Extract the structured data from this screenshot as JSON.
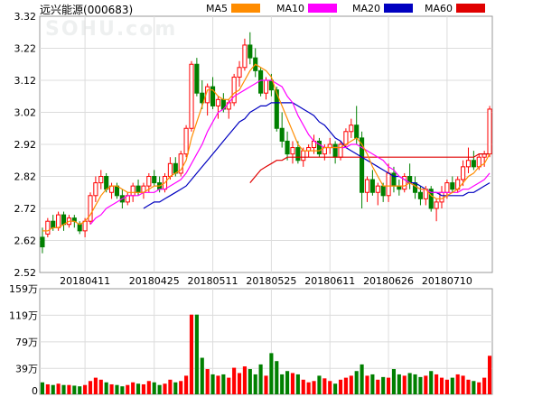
{
  "header": {
    "stock_title": "远兴能源",
    "stock_code": "(000683)",
    "watermark": "SOHU.com"
  },
  "legend": [
    {
      "name": "MA5",
      "color": "#ff8c00"
    },
    {
      "name": "MA10",
      "color": "#ff00ff"
    },
    {
      "name": "MA20",
      "color": "#0000c0"
    },
    {
      "name": "MA60",
      "color": "#e00000"
    }
  ],
  "chart_data": [
    {
      "type": "candlestick",
      "ylim": [
        2.52,
        3.32
      ],
      "y_ticks": [
        "3.32",
        "3.22",
        "3.12",
        "3.02",
        "2.92",
        "2.82",
        "2.72",
        "2.62",
        "2.52"
      ],
      "x_ticks": [
        "20180411",
        "20180425",
        "20180511",
        "20180525",
        "20180611",
        "20180626",
        "20180710"
      ],
      "up_color": "#ff0000",
      "down_color": "#008000",
      "ohlc": [
        [
          2.63,
          2.66,
          2.58,
          2.6
        ],
        [
          2.64,
          2.69,
          2.63,
          2.68
        ],
        [
          2.68,
          2.7,
          2.65,
          2.66
        ],
        [
          2.66,
          2.71,
          2.65,
          2.7
        ],
        [
          2.7,
          2.71,
          2.65,
          2.67
        ],
        [
          2.67,
          2.7,
          2.66,
          2.69
        ],
        [
          2.69,
          2.7,
          2.66,
          2.68
        ],
        [
          2.67,
          2.68,
          2.64,
          2.65
        ],
        [
          2.65,
          2.69,
          2.63,
          2.68
        ],
        [
          2.68,
          2.77,
          2.67,
          2.76
        ],
        [
          2.76,
          2.82,
          2.74,
          2.8
        ],
        [
          2.8,
          2.84,
          2.78,
          2.82
        ],
        [
          2.82,
          2.83,
          2.77,
          2.78
        ],
        [
          2.77,
          2.8,
          2.75,
          2.79
        ],
        [
          2.79,
          2.8,
          2.75,
          2.76
        ],
        [
          2.76,
          2.78,
          2.72,
          2.74
        ],
        [
          2.74,
          2.77,
          2.73,
          2.76
        ],
        [
          2.76,
          2.8,
          2.74,
          2.79
        ],
        [
          2.79,
          2.81,
          2.76,
          2.77
        ],
        [
          2.77,
          2.8,
          2.75,
          2.79
        ],
        [
          2.79,
          2.83,
          2.77,
          2.82
        ],
        [
          2.82,
          2.84,
          2.79,
          2.8
        ],
        [
          2.8,
          2.82,
          2.77,
          2.78
        ],
        [
          2.78,
          2.83,
          2.77,
          2.82
        ],
        [
          2.82,
          2.88,
          2.81,
          2.86
        ],
        [
          2.86,
          2.88,
          2.82,
          2.83
        ],
        [
          2.83,
          2.9,
          2.82,
          2.89
        ],
        [
          2.89,
          2.98,
          2.88,
          2.97
        ],
        [
          2.97,
          3.18,
          2.96,
          3.17
        ],
        [
          3.17,
          3.19,
          3.07,
          3.08
        ],
        [
          3.08,
          3.12,
          3.03,
          3.05
        ],
        [
          3.05,
          3.11,
          3.01,
          3.1
        ],
        [
          3.1,
          3.13,
          3.03,
          3.04
        ],
        [
          3.04,
          3.07,
          3.0,
          3.06
        ],
        [
          3.06,
          3.08,
          3.02,
          3.03
        ],
        [
          3.03,
          3.06,
          3.0,
          3.05
        ],
        [
          3.05,
          3.14,
          3.04,
          3.13
        ],
        [
          3.13,
          3.18,
          3.1,
          3.16
        ],
        [
          3.16,
          3.25,
          3.15,
          3.23
        ],
        [
          3.23,
          3.27,
          3.17,
          3.19
        ],
        [
          3.19,
          3.22,
          3.13,
          3.15
        ],
        [
          3.15,
          3.16,
          3.07,
          3.08
        ],
        [
          3.08,
          3.13,
          3.06,
          3.12
        ],
        [
          3.12,
          3.14,
          3.07,
          3.09
        ],
        [
          3.09,
          3.1,
          2.96,
          2.97
        ],
        [
          2.97,
          3.02,
          2.91,
          2.93
        ],
        [
          2.93,
          2.96,
          2.87,
          2.89
        ],
        [
          2.89,
          2.93,
          2.86,
          2.91
        ],
        [
          2.91,
          2.93,
          2.86,
          2.87
        ],
        [
          2.87,
          2.91,
          2.85,
          2.9
        ],
        [
          2.9,
          2.92,
          2.88,
          2.91
        ],
        [
          2.91,
          2.95,
          2.89,
          2.93
        ],
        [
          2.93,
          2.94,
          2.88,
          2.89
        ],
        [
          2.89,
          2.92,
          2.87,
          2.91
        ],
        [
          2.91,
          2.94,
          2.89,
          2.92
        ],
        [
          2.92,
          2.93,
          2.86,
          2.88
        ],
        [
          2.88,
          2.93,
          2.87,
          2.92
        ],
        [
          2.92,
          2.97,
          2.91,
          2.96
        ],
        [
          2.96,
          3.0,
          2.94,
          2.98
        ],
        [
          2.98,
          3.04,
          2.92,
          2.94
        ],
        [
          2.94,
          2.96,
          2.72,
          2.77
        ],
        [
          2.77,
          2.82,
          2.74,
          2.81
        ],
        [
          2.81,
          2.84,
          2.76,
          2.77
        ],
        [
          2.77,
          2.8,
          2.73,
          2.79
        ],
        [
          2.79,
          2.8,
          2.74,
          2.76
        ],
        [
          2.76,
          2.86,
          2.74,
          2.83
        ],
        [
          2.83,
          2.85,
          2.77,
          2.79
        ],
        [
          2.79,
          2.81,
          2.76,
          2.78
        ],
        [
          2.78,
          2.83,
          2.77,
          2.82
        ],
        [
          2.82,
          2.86,
          2.78,
          2.8
        ],
        [
          2.8,
          2.82,
          2.75,
          2.77
        ],
        [
          2.77,
          2.79,
          2.73,
          2.75
        ],
        [
          2.75,
          2.79,
          2.73,
          2.78
        ],
        [
          2.78,
          2.79,
          2.71,
          2.72
        ],
        [
          2.72,
          2.75,
          2.68,
          2.74
        ],
        [
          2.74,
          2.79,
          2.72,
          2.77
        ],
        [
          2.77,
          2.81,
          2.75,
          2.8
        ],
        [
          2.8,
          2.82,
          2.77,
          2.78
        ],
        [
          2.78,
          2.82,
          2.77,
          2.81
        ],
        [
          2.81,
          2.87,
          2.79,
          2.85
        ],
        [
          2.85,
          2.91,
          2.83,
          2.87
        ],
        [
          2.87,
          2.9,
          2.84,
          2.85
        ],
        [
          2.85,
          2.89,
          2.84,
          2.88
        ],
        [
          2.88,
          2.9,
          2.85,
          2.89
        ],
        [
          2.89,
          3.04,
          2.88,
          3.03
        ]
      ],
      "ma5": [
        2.65,
        2.65,
        2.66,
        2.66,
        2.67,
        2.68,
        2.68,
        2.67,
        2.68,
        2.7,
        2.73,
        2.76,
        2.78,
        2.79,
        2.79,
        2.78,
        2.77,
        2.77,
        2.77,
        2.77,
        2.78,
        2.79,
        2.79,
        2.8,
        2.82,
        2.83,
        2.84,
        2.87,
        2.94,
        2.99,
        3.04,
        3.09,
        3.09,
        3.07,
        3.06,
        3.06,
        3.08,
        3.09,
        3.12,
        3.15,
        3.17,
        3.16,
        3.15,
        3.13,
        3.08,
        3.04,
        3.0,
        2.96,
        2.92,
        2.9,
        2.9,
        2.9,
        2.9,
        2.91,
        2.91,
        2.91,
        2.91,
        2.92,
        2.93,
        2.94,
        2.92,
        2.89,
        2.85,
        2.82,
        2.79,
        2.79,
        2.79,
        2.79,
        2.79,
        2.8,
        2.79,
        2.78,
        2.78,
        2.76,
        2.75,
        2.75,
        2.76,
        2.77,
        2.78,
        2.8,
        2.82,
        2.83,
        2.85,
        2.86,
        2.89
      ],
      "ma10": [
        null,
        null,
        null,
        null,
        null,
        null,
        null,
        null,
        null,
        2.67,
        2.69,
        2.7,
        2.72,
        2.73,
        2.74,
        2.75,
        2.76,
        2.76,
        2.76,
        2.77,
        2.77,
        2.77,
        2.78,
        2.78,
        2.79,
        2.8,
        2.81,
        2.83,
        2.86,
        2.89,
        2.92,
        2.96,
        2.99,
        3.02,
        3.03,
        3.05,
        3.07,
        3.08,
        3.09,
        3.1,
        3.11,
        3.12,
        3.12,
        3.12,
        3.11,
        3.1,
        3.07,
        3.05,
        3.01,
        2.98,
        2.95,
        2.93,
        2.92,
        2.91,
        2.91,
        2.91,
        2.91,
        2.91,
        2.92,
        2.92,
        2.91,
        2.9,
        2.89,
        2.88,
        2.87,
        2.85,
        2.84,
        2.82,
        2.81,
        2.8,
        2.79,
        2.78,
        2.78,
        2.77,
        2.77,
        2.77,
        2.77,
        2.77,
        2.77,
        2.78,
        2.78,
        2.79,
        2.8,
        2.81,
        2.83
      ],
      "ma20": [
        null,
        null,
        null,
        null,
        null,
        null,
        null,
        null,
        null,
        null,
        null,
        null,
        null,
        null,
        null,
        null,
        null,
        null,
        null,
        2.72,
        2.73,
        2.74,
        2.74,
        2.75,
        2.76,
        2.77,
        2.78,
        2.79,
        2.81,
        2.83,
        2.85,
        2.87,
        2.89,
        2.91,
        2.93,
        2.95,
        2.97,
        2.99,
        3.0,
        3.02,
        3.03,
        3.04,
        3.04,
        3.05,
        3.05,
        3.05,
        3.05,
        3.05,
        3.04,
        3.03,
        3.02,
        3.01,
        2.99,
        2.98,
        2.96,
        2.94,
        2.93,
        2.91,
        2.9,
        2.89,
        2.88,
        2.87,
        2.86,
        2.85,
        2.84,
        2.83,
        2.82,
        2.82,
        2.81,
        2.8,
        2.8,
        2.79,
        2.78,
        2.77,
        2.77,
        2.76,
        2.76,
        2.76,
        2.76,
        2.76,
        2.77,
        2.77,
        2.78,
        2.79,
        2.8
      ],
      "ma60": [
        null,
        null,
        null,
        null,
        null,
        null,
        null,
        null,
        null,
        null,
        null,
        null,
        null,
        null,
        null,
        null,
        null,
        null,
        null,
        null,
        null,
        null,
        null,
        null,
        null,
        null,
        null,
        null,
        null,
        null,
        null,
        null,
        null,
        null,
        null,
        null,
        null,
        null,
        null,
        2.8,
        2.82,
        2.84,
        2.85,
        2.86,
        2.87,
        2.87,
        2.88,
        2.88,
        2.88,
        2.88,
        2.88,
        2.88,
        2.88,
        2.88,
        2.88,
        2.88,
        2.88,
        2.88,
        2.88,
        2.88,
        2.88,
        2.88,
        2.88,
        2.88,
        2.88,
        2.88,
        2.88,
        2.88,
        2.88,
        2.88,
        2.88,
        2.88,
        2.88,
        2.88,
        2.88,
        2.88,
        2.88,
        2.88,
        2.88,
        2.88,
        2.88,
        2.88,
        2.89,
        2.89,
        2.89
      ]
    },
    {
      "type": "bar",
      "ylim": [
        0,
        159
      ],
      "y_ticks": [
        "159万",
        "119万",
        "79万",
        "39万",
        "0"
      ],
      "volume": [
        18,
        15,
        14,
        16,
        14,
        14,
        13,
        12,
        14,
        20,
        25,
        22,
        18,
        15,
        14,
        12,
        14,
        18,
        16,
        15,
        20,
        18,
        14,
        16,
        22,
        18,
        20,
        28,
        120,
        120,
        55,
        38,
        30,
        28,
        30,
        25,
        40,
        32,
        42,
        38,
        30,
        45,
        28,
        62,
        50,
        30,
        35,
        32,
        30,
        22,
        18,
        20,
        28,
        24,
        20,
        16,
        22,
        25,
        28,
        35,
        45,
        28,
        30,
        22,
        26,
        25,
        38,
        30,
        28,
        32,
        30,
        26,
        28,
        35,
        30,
        25,
        22,
        25,
        30,
        28,
        22,
        20,
        18,
        25,
        58
      ]
    }
  ]
}
